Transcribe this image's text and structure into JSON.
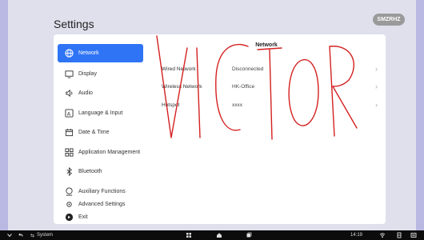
{
  "header": {
    "title": "Settings",
    "badge": "SMZRHZ"
  },
  "sidebar": {
    "items": [
      {
        "label": "Network",
        "icon": "globe-icon",
        "active": true
      },
      {
        "label": "Display",
        "icon": "monitor-icon",
        "active": false
      },
      {
        "label": "Audio",
        "icon": "speaker-icon",
        "active": false
      },
      {
        "label": "Language & Input",
        "icon": "language-icon",
        "active": false
      },
      {
        "label": "Date & Time",
        "icon": "calendar-icon",
        "active": false
      },
      {
        "label": "Application Management",
        "icon": "apps-icon",
        "active": false
      },
      {
        "label": "Bluetooth",
        "icon": "bluetooth-icon",
        "active": false
      },
      {
        "label": "Auxiliary Functions",
        "icon": "accessibility-icon",
        "active": false
      },
      {
        "label": "Advanced Settings",
        "icon": "advanced-icon",
        "active": false
      }
    ],
    "exit_label": "Exit"
  },
  "network": {
    "title": "Network",
    "rows": [
      {
        "label": "Wired Network",
        "value": "Disconnected"
      },
      {
        "label": "Wireless Network",
        "value": "HK-Office"
      },
      {
        "label": "Hotspot",
        "value": "xxxx"
      }
    ]
  },
  "annotation": {
    "text": "VICTOR",
    "color": "#d42020"
  },
  "taskbar": {
    "system_label": "System",
    "time": "14:19"
  },
  "colors": {
    "accent": "#2f74f5",
    "frame": "#b9b8e3",
    "background": "#dfe0ec",
    "taskbar": "#0c0c0c"
  }
}
